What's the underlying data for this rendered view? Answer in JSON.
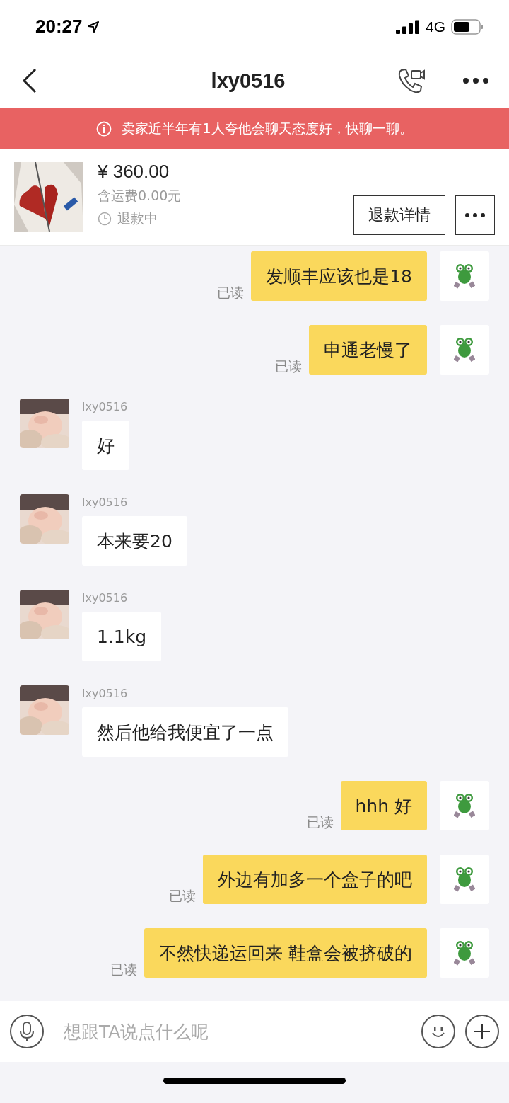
{
  "status_bar": {
    "time": "20:27",
    "network": "4G"
  },
  "nav": {
    "title": "lxy0516"
  },
  "banner": {
    "text": "卖家近半年有1人夸他会聊天态度好，快聊一聊。"
  },
  "product": {
    "kind": "picture",
    "price": "¥ 360.00",
    "shipping": "含运费0.00元",
    "status": "退款中",
    "button": "退款详情"
  },
  "messages": [
    {
      "kind": "sent",
      "text": "发顺丰应该也是18",
      "receipt": "已读"
    },
    {
      "kind": "sent",
      "text": "申通老慢了",
      "receipt": "已读"
    },
    {
      "kind": "received",
      "sender": "lxy0516",
      "text": "好"
    },
    {
      "kind": "received",
      "sender": "lxy0516",
      "text": "本来要20"
    },
    {
      "kind": "received",
      "sender": "lxy0516",
      "text": "1.1kg"
    },
    {
      "kind": "received",
      "sender": "lxy0516",
      "text": "然后他给我便宜了一点"
    },
    {
      "kind": "sent",
      "text": "hhh 好",
      "receipt": "已读"
    },
    {
      "kind": "sent",
      "text": "外边有加多一个盒子的吧",
      "receipt": "已读"
    },
    {
      "kind": "sent",
      "text": "不然快递运回来 鞋盒会被挤破的",
      "receipt": "已读"
    }
  ],
  "input": {
    "placeholder": "想跟TA说点什么呢"
  }
}
